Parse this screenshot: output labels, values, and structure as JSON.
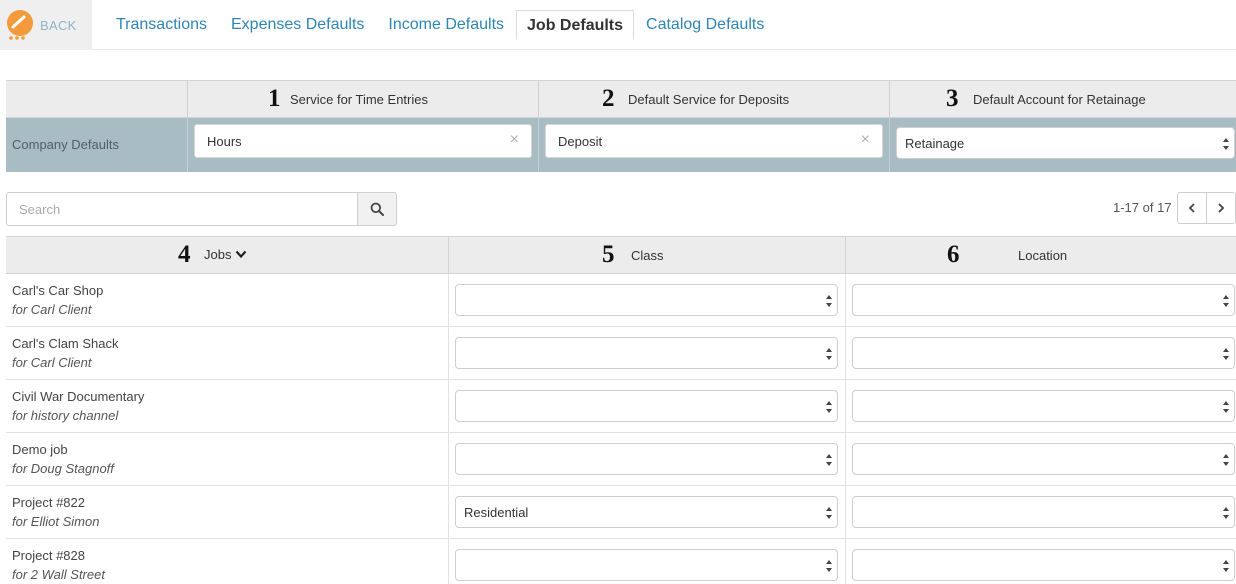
{
  "nav": {
    "back_label": "BACK",
    "tabs": [
      {
        "label": "Transactions",
        "active": false
      },
      {
        "label": "Expenses Defaults",
        "active": false
      },
      {
        "label": "Income Defaults",
        "active": false
      },
      {
        "label": "Job Defaults",
        "active": true
      },
      {
        "label": "Catalog Defaults",
        "active": false
      }
    ]
  },
  "company_defaults": {
    "row_label": "Company Defaults",
    "columns": [
      {
        "num": "1",
        "title": "Service for Time Entries",
        "value": "Hours",
        "control": "clearable-input"
      },
      {
        "num": "2",
        "title": "Default Service for Deposits",
        "value": "Deposit",
        "control": "clearable-input"
      },
      {
        "num": "3",
        "title": "Default Account for Retainage",
        "value": "Retainage",
        "control": "select"
      }
    ]
  },
  "search": {
    "placeholder": "Search"
  },
  "pager": {
    "text": "1-17 of 17"
  },
  "jobs_table": {
    "headers": [
      {
        "num": "4",
        "label": "Jobs"
      },
      {
        "num": "5",
        "label": "Class"
      },
      {
        "num": "6",
        "label": "Location"
      }
    ],
    "rows": [
      {
        "name": "Carl's Car Shop",
        "client": "for Carl Client",
        "class": "",
        "location": ""
      },
      {
        "name": "Carl's Clam Shack",
        "client": "for Carl Client",
        "class": "",
        "location": ""
      },
      {
        "name": "Civil War Documentary",
        "client": "for history channel",
        "class": "",
        "location": ""
      },
      {
        "name": "Demo job",
        "client": "for Doug Stagnoff",
        "class": "",
        "location": ""
      },
      {
        "name": "Project #822",
        "client": "for Elliot Simon",
        "class": "Residential",
        "location": ""
      },
      {
        "name": "Project #828",
        "client": "for 2 Wall Street",
        "class": "",
        "location": ""
      }
    ]
  },
  "colors": {
    "accent_link": "#2f86b4",
    "gauge_orange": "#f29a3c",
    "company_row_bg": "#a7bcc3"
  },
  "icons": {
    "back": "gauge-icon",
    "search": "search-icon",
    "sort": "chevron-down-icon",
    "prev": "chevron-left-icon",
    "next": "chevron-right-icon",
    "clear": "close-icon",
    "select": "select-arrows-icon"
  }
}
